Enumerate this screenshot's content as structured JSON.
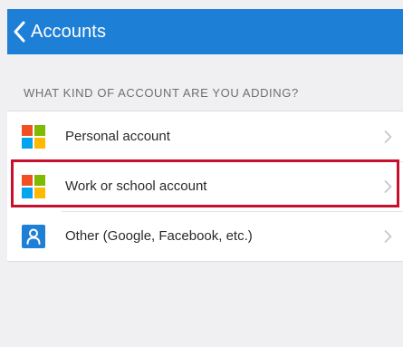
{
  "header": {
    "back_label": "Accounts",
    "background_color": "#1e7fd6"
  },
  "section": {
    "heading": "WHAT KIND OF ACCOUNT ARE YOU ADDING?"
  },
  "accounts": [
    {
      "label": "Personal account",
      "icon": "microsoft-logo-icon"
    },
    {
      "label": "Work or school account",
      "icon": "microsoft-logo-icon",
      "highlighted": true
    },
    {
      "label": "Other (Google, Facebook, etc.)",
      "icon": "person-icon"
    }
  ],
  "colors": {
    "highlight_border": "#c8102e",
    "ms_red": "#f25022",
    "ms_green": "#7fba00",
    "ms_blue": "#00a4ef",
    "ms_yellow": "#ffb900",
    "person_icon_blue": "#1e7fd6"
  }
}
